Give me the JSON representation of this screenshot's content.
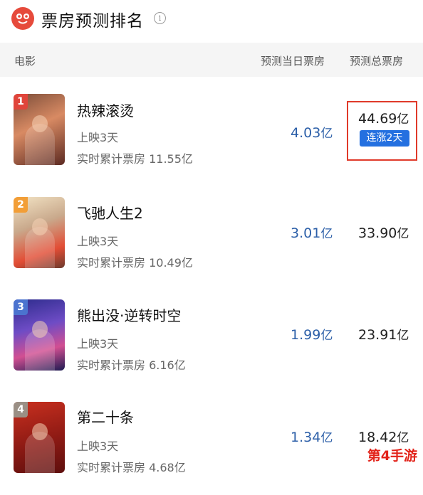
{
  "header": {
    "title": "票房预测排名",
    "info_icon": "i"
  },
  "columns": {
    "movie": "电影",
    "today": "预测当日票房",
    "total": "预测总票房"
  },
  "movies": [
    {
      "rank": "1",
      "name": "热辣滚烫",
      "days": "上映3天",
      "live": "实时累计票房 11.55亿",
      "today": "4.03",
      "total": "44.69",
      "unit": "亿",
      "badge": "连涨2天"
    },
    {
      "rank": "2",
      "name": "飞驰人生2",
      "days": "上映3天",
      "live": "实时累计票房 10.49亿",
      "today": "3.01",
      "total": "33.90",
      "unit": "亿"
    },
    {
      "rank": "3",
      "name": "熊出没·逆转时空",
      "days": "上映3天",
      "live": "实时累计票房 6.16亿",
      "today": "1.99",
      "total": "23.91",
      "unit": "亿"
    },
    {
      "rank": "4",
      "name": "第二十条",
      "days": "上映3天",
      "live": "实时累计票房 4.68亿",
      "today": "1.34",
      "total": "18.42",
      "unit": "亿"
    }
  ],
  "watermark": "第4手游",
  "colors": {
    "accent_blue": "#2c5fa8",
    "badge_blue": "#2470e0",
    "highlight_red": "#e03a2a",
    "brand_red": "#e64a3b"
  }
}
